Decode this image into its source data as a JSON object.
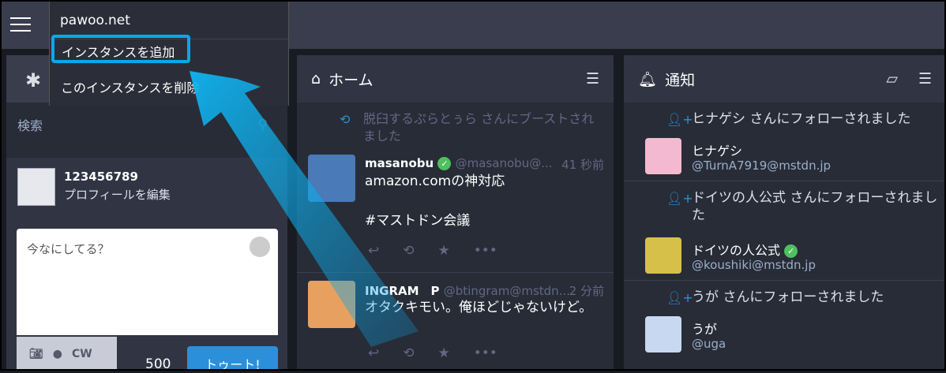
{
  "dropdown": {
    "current": "pawoo.net",
    "add_label": "インスタンスを追加",
    "delete_label": "このインスタンスを削除"
  },
  "left": {
    "search_placeholder": "検索",
    "profile_name": "123456789",
    "profile_edit": "プロフィールを編集",
    "compose_placeholder": "今なにしてる？",
    "cw_label": "CW",
    "char_count": "500",
    "toot_label": "トゥート!"
  },
  "home": {
    "title": "ホーム",
    "boost_text": "脱臼するぷらとぅら さんにブーストされました",
    "statuses": [
      {
        "name": "masanobu",
        "acct": "@masanobu@...",
        "time": "41 秒前",
        "body": "amazon.comの神対応\n\n#マストドン会議"
      },
      {
        "name": "INGRAM　P",
        "acct": "@btingram@mstdn...",
        "time": "2 分前",
        "body": "オタクキモい。俺ほどじゃないけど。"
      }
    ]
  },
  "notifications": {
    "title": "通知",
    "items": [
      {
        "header": "ヒナゲシ さんにフォローされました",
        "name": "ヒナゲシ",
        "handle": "@TurnA7919@mstdn.jp"
      },
      {
        "header": "ドイツの人公式 さんにフォローされました",
        "name": "ドイツの人公式",
        "handle": "@koushiki@mstdn.jp"
      },
      {
        "header": "うが さんにフォローされました",
        "name": "うが",
        "handle": "@uga"
      }
    ]
  },
  "colors": {
    "accent": "#2b90d9",
    "highlight": "#0aa8ea",
    "verified": "#4ec05e"
  }
}
